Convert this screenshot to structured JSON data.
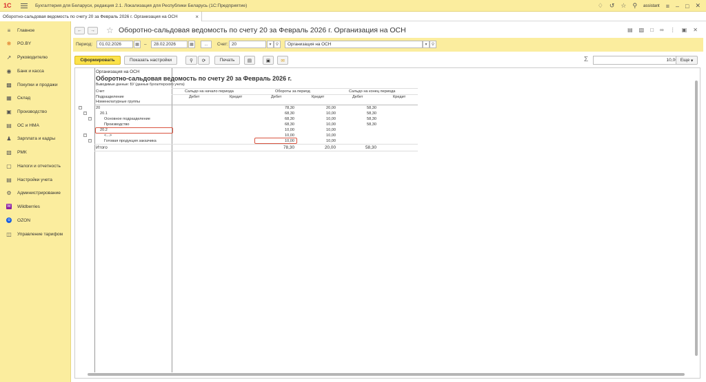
{
  "titlebar": {
    "logo": "1С",
    "title": "Бухгалтерия для Беларуси, редакция 2.1. Локализация для Республики Беларусь   (1С:Предприятие)",
    "user": "assistant"
  },
  "tab": {
    "label": "Оборотно-сальдовая ведомость по счету 20 за Февраль 2026 г. Организация на ОСН"
  },
  "sidebar": {
    "items": [
      {
        "label": "Главное",
        "icon": "menu-icon"
      },
      {
        "label": "PO.BY",
        "icon": "gear-icon"
      },
      {
        "label": "Руководителю",
        "icon": "trend-icon"
      },
      {
        "label": "Банк и касса",
        "icon": "bank-icon"
      },
      {
        "label": "Покупки и продажи",
        "icon": "cart-icon"
      },
      {
        "label": "Склад",
        "icon": "warehouse-icon"
      },
      {
        "label": "Производство",
        "icon": "factory-icon"
      },
      {
        "label": "ОС и НМА",
        "icon": "truck-icon"
      },
      {
        "label": "Зарплата и кадры",
        "icon": "people-icon"
      },
      {
        "label": "РМК",
        "icon": "printer-icon"
      },
      {
        "label": "Налоги и отчетность",
        "icon": "chart-icon"
      },
      {
        "label": "Настройки учета",
        "icon": "settings-doc-icon"
      },
      {
        "label": "Администрирование",
        "icon": "gear-icon"
      },
      {
        "label": "Wildberries",
        "icon": "wb-icon"
      },
      {
        "label": "OZON",
        "icon": "ozon-icon"
      },
      {
        "label": "Управление тарифом",
        "icon": "grid-icon"
      }
    ]
  },
  "header": {
    "title": "Оборотно-сальдовая ведомость по счету 20 за Февраль 2026 г. Организация на ОСН"
  },
  "params": {
    "period_label": "Период:",
    "date_from": "01.02.2026",
    "dash": "–",
    "date_to": "28.02.2026",
    "dots": "...",
    "account_label": "Счет:",
    "account": "20",
    "organization": "Организация на ОСН"
  },
  "toolbar": {
    "generate": "Сформировать",
    "show_settings": "Показать настройки",
    "print": "Печать",
    "more": "Еще",
    "sum_value": "10,00"
  },
  "report": {
    "org": "Организация на ОСН",
    "title": "Оборотно-сальдовая ведомость по счету 20 за Февраль 2026 г.",
    "subtitle": "Выводимые данные:  БУ (данные бухгалтерского учета)",
    "row_headers": [
      "Счет",
      "Подразделение",
      "Номенклатурные группы"
    ],
    "col_groups": [
      "Сальдо на начало периода",
      "Обороты за период",
      "Сальдо на конец периода"
    ],
    "debit": "Дебет",
    "credit": "Кредит",
    "rows": [
      {
        "label": "20",
        "ob_d": "78,30",
        "ob_c": "20,00",
        "end_d": "58,30"
      },
      {
        "label": "20.1",
        "ob_d": "68,30",
        "ob_c": "10,00",
        "end_d": "58,30"
      },
      {
        "label": "Основное подразделение",
        "ob_d": "68,30",
        "ob_c": "10,00",
        "end_d": "58,30"
      },
      {
        "label": "Производство",
        "ob_d": "68,30",
        "ob_c": "10,00",
        "end_d": "58,30"
      },
      {
        "label": "20.2",
        "ob_d": "10,00",
        "ob_c": "10,00",
        "end_d": ""
      },
      {
        "label": "<...>",
        "ob_d": "10,00",
        "ob_c": "10,00",
        "end_d": ""
      },
      {
        "label": "Готовая продукция заказчика",
        "ob_d": "10,00",
        "ob_c": "10,00",
        "end_d": ""
      }
    ],
    "total": {
      "label": "Итого",
      "ob_d": "78,30",
      "ob_c": "20,00",
      "end_d": "58,30"
    }
  }
}
